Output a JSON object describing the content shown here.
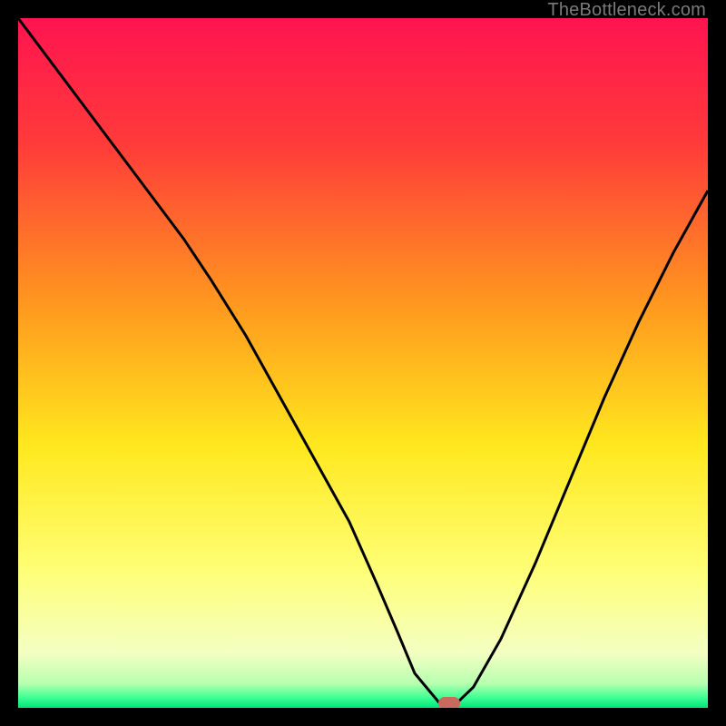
{
  "watermark": "TheBottleneck.com",
  "chart_data": {
    "type": "line",
    "title": "",
    "xlabel": "",
    "ylabel": "",
    "xlim": [
      0,
      100
    ],
    "ylim": [
      0,
      100
    ],
    "grid": false,
    "gradient_stops": [
      {
        "pct": 0,
        "color": "#ff1450"
      },
      {
        "pct": 18,
        "color": "#ff3a3a"
      },
      {
        "pct": 42,
        "color": "#ff9a1e"
      },
      {
        "pct": 62,
        "color": "#ffe81e"
      },
      {
        "pct": 80,
        "color": "#ffff76"
      },
      {
        "pct": 92,
        "color": "#f4ffc2"
      },
      {
        "pct": 96.5,
        "color": "#b7ffb0"
      },
      {
        "pct": 98.5,
        "color": "#3fff94"
      },
      {
        "pct": 100,
        "color": "#00e57a"
      }
    ],
    "series": [
      {
        "name": "bottleneck-curve",
        "color": "#000000",
        "x": [
          0,
          6,
          12,
          18,
          24,
          28,
          33,
          38,
          43,
          48,
          52,
          55,
          57.5,
          61,
          61.5,
          63.5,
          66,
          70,
          75,
          80,
          85,
          90,
          95,
          100
        ],
        "y": [
          100,
          92,
          84,
          76,
          68,
          62,
          54,
          45,
          36,
          27,
          18,
          11,
          5,
          0.8,
          0.6,
          0.6,
          3,
          10,
          21,
          33,
          45,
          56,
          66,
          75
        ]
      }
    ],
    "marker": {
      "name": "highlight-marker",
      "x": 62.5,
      "y": 0.6,
      "color": "#c96a5f"
    }
  }
}
